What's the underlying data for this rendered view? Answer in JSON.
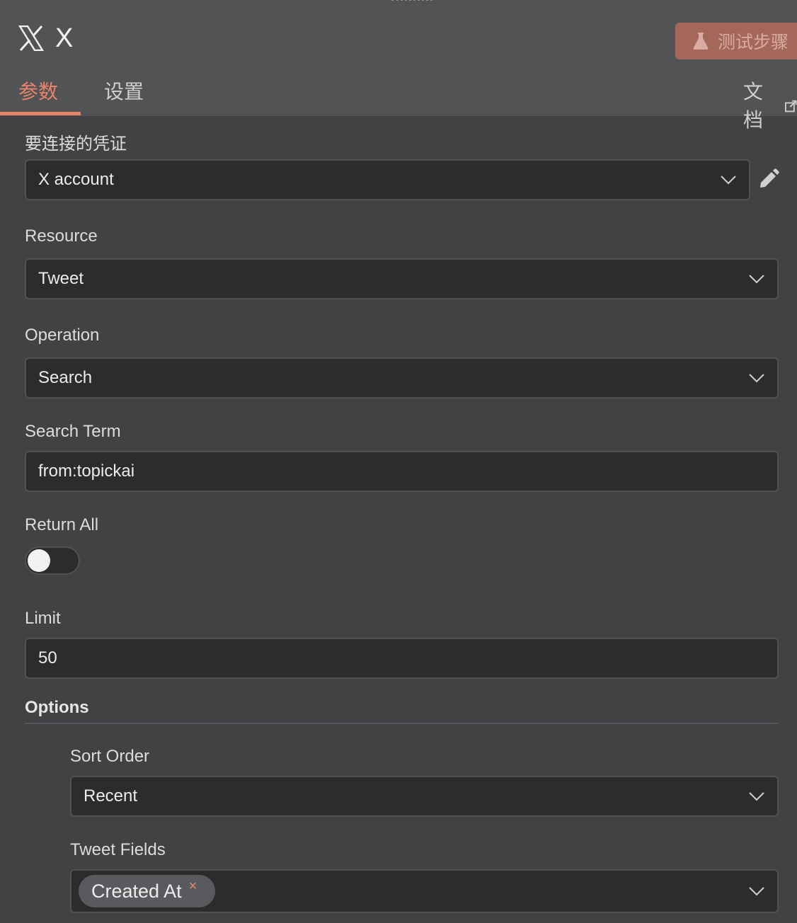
{
  "header": {
    "title": "X",
    "test_button_label": "测试步骤",
    "icons": {
      "logo": "x-logo-icon",
      "flask": "flask-icon",
      "external": "external-link-icon"
    },
    "colors": {
      "accent": "#e8836b",
      "test_button_bg": "#a5675a"
    }
  },
  "tabs": [
    {
      "label": "参数",
      "active": true
    },
    {
      "label": "设置",
      "active": false
    },
    {
      "label": "文档",
      "active": false
    }
  ],
  "form": {
    "credential": {
      "label": "要连接的凭证",
      "value": "X account"
    },
    "resource": {
      "label": "Resource",
      "value": "Tweet"
    },
    "operation": {
      "label": "Operation",
      "value": "Search"
    },
    "search_term": {
      "label": "Search Term",
      "value": "from:topickai"
    },
    "return_all": {
      "label": "Return All",
      "enabled": false
    },
    "limit": {
      "label": "Limit",
      "value": "50"
    },
    "options": {
      "title": "Options",
      "sort_order": {
        "label": "Sort Order",
        "value": "Recent"
      },
      "tweet_fields": {
        "label": "Tweet Fields",
        "chips": [
          "Created At"
        ],
        "remove_glyph": "×"
      }
    }
  }
}
